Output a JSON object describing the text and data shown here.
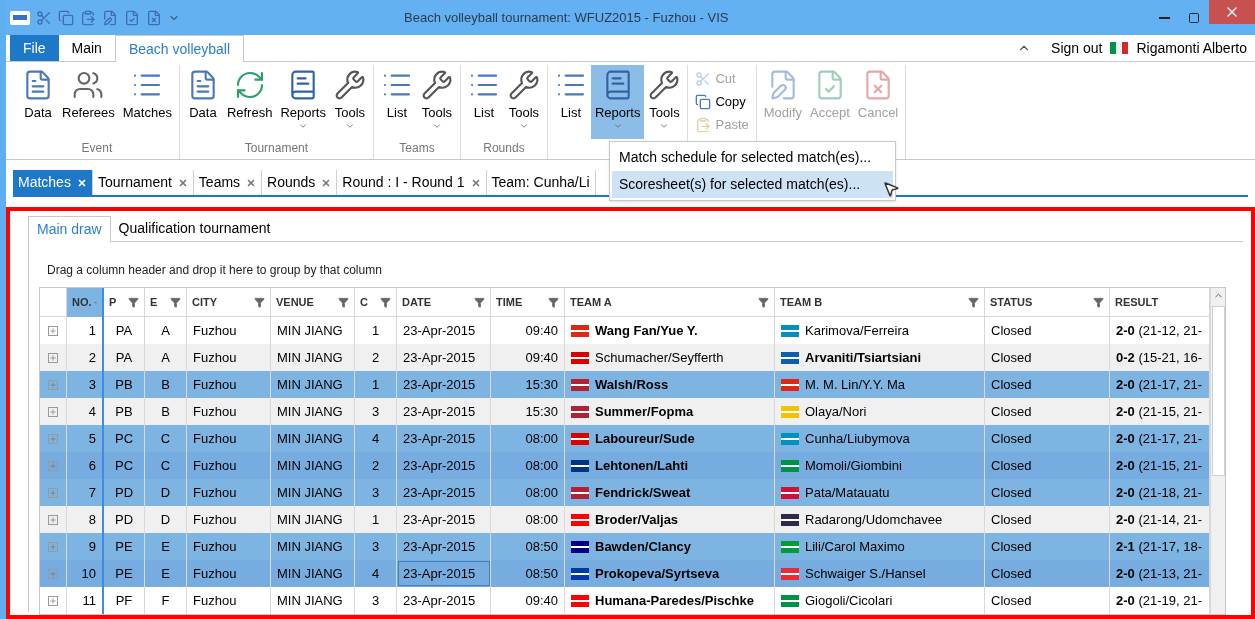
{
  "window": {
    "title": "Beach volleyball tournament: WFUZ2015 - Fuzhou - VIS"
  },
  "ribbon_tabs": [
    {
      "label": "File",
      "kind": "file",
      "selected": false
    },
    {
      "label": "Main",
      "kind": "tab",
      "selected": false
    },
    {
      "label": "Beach volleyball",
      "kind": "tab",
      "selected": true
    }
  ],
  "user": {
    "sign_out": "Sign out",
    "name": "Rigamonti Alberto"
  },
  "ribbon_groups": [
    {
      "label": "Event",
      "buttons": [
        {
          "label": "Data",
          "kind": "large",
          "dropdown": false,
          "pressed": false,
          "disabled": false
        },
        {
          "label": "Referees",
          "kind": "large",
          "dropdown": false,
          "pressed": false,
          "disabled": false
        },
        {
          "label": "Matches",
          "kind": "large",
          "dropdown": false,
          "pressed": false,
          "disabled": false
        }
      ]
    },
    {
      "label": "Tournament",
      "buttons": [
        {
          "label": "Data",
          "kind": "large",
          "dropdown": false,
          "pressed": false,
          "disabled": false
        },
        {
          "label": "Refresh",
          "kind": "large",
          "dropdown": false,
          "pressed": false,
          "disabled": false
        },
        {
          "label": "Reports",
          "kind": "large",
          "dropdown": true,
          "pressed": false,
          "disabled": false
        },
        {
          "label": "Tools",
          "kind": "large",
          "dropdown": true,
          "pressed": false,
          "disabled": false
        }
      ]
    },
    {
      "label": "Teams",
      "buttons": [
        {
          "label": "List",
          "kind": "large",
          "dropdown": false,
          "pressed": false,
          "disabled": false
        },
        {
          "label": "Tools",
          "kind": "large",
          "dropdown": true,
          "pressed": false,
          "disabled": false
        }
      ]
    },
    {
      "label": "Rounds",
      "buttons": [
        {
          "label": "List",
          "kind": "large",
          "dropdown": false,
          "pressed": false,
          "disabled": false
        },
        {
          "label": "Tools",
          "kind": "large",
          "dropdown": true,
          "pressed": false,
          "disabled": false
        }
      ]
    },
    {
      "buttons": [
        {
          "label": "List",
          "kind": "large",
          "dropdown": false,
          "pressed": false,
          "disabled": false
        },
        {
          "label": "Reports",
          "kind": "large",
          "dropdown": true,
          "pressed": true,
          "disabled": false
        },
        {
          "label": "Tools",
          "kind": "large",
          "dropdown": true,
          "pressed": false,
          "disabled": false
        }
      ]
    },
    {
      "buttons": [
        {
          "label": "Cut",
          "kind": "small",
          "disabled": true
        },
        {
          "label": "Copy",
          "kind": "small",
          "disabled": false
        },
        {
          "label": "Paste",
          "kind": "small",
          "disabled": true
        }
      ]
    },
    {
      "buttons": [
        {
          "label": "Modify",
          "kind": "large",
          "dropdown": false,
          "pressed": false,
          "disabled": true
        },
        {
          "label": "Accept",
          "kind": "large",
          "dropdown": false,
          "pressed": false,
          "disabled": true
        },
        {
          "label": "Cancel",
          "kind": "large",
          "dropdown": false,
          "pressed": false,
          "disabled": true
        }
      ]
    }
  ],
  "reports_menu": {
    "items": [
      {
        "label": "Match schedule for selected match(es)...",
        "selected": false
      },
      {
        "label": "Scoresheet(s) for selected match(es)...",
        "selected": true
      }
    ]
  },
  "document_tabs": [
    {
      "label": "Matches",
      "selected": true
    },
    {
      "label": "Tournament",
      "selected": false
    },
    {
      "label": "Teams",
      "selected": false
    },
    {
      "label": "Rounds",
      "selected": false
    },
    {
      "label": "Round : I - Round 1",
      "selected": false
    },
    {
      "label": "Team: Cunha/Li",
      "selected": false
    }
  ],
  "view_tabs": [
    {
      "label": "Main draw",
      "selected": true
    },
    {
      "label": "Qualification tournament",
      "selected": false
    }
  ],
  "group_hint": "Drag a column header and drop it here to group by that column",
  "table": {
    "columns": [
      {
        "label": "NO.",
        "sorted": true,
        "filter": false
      },
      {
        "label": "P",
        "sorted": false,
        "filter": true
      },
      {
        "label": "E",
        "sorted": false,
        "filter": true
      },
      {
        "label": "CITY",
        "sorted": false,
        "filter": true
      },
      {
        "label": "VENUE",
        "sorted": false,
        "filter": true
      },
      {
        "label": "C",
        "sorted": false,
        "filter": true
      },
      {
        "label": "DATE",
        "sorted": false,
        "filter": true
      },
      {
        "label": "TIME",
        "sorted": false,
        "filter": true
      },
      {
        "label": "TEAM A",
        "sorted": false,
        "filter": true
      },
      {
        "label": "TEAM B",
        "sorted": false,
        "filter": true
      },
      {
        "label": "STATUS",
        "sorted": false,
        "filter": true
      },
      {
        "label": "RESULT",
        "sorted": false,
        "filter": false
      }
    ],
    "rows": [
      {
        "no": "1",
        "pool": "PA",
        "e": "A",
        "city": "Fuzhou",
        "venue": "MIN JIANG",
        "court": "1",
        "date": "23-Apr-2015",
        "time": "09:40",
        "team_a": {
          "name": "Wang Fan/Yue Y.",
          "color": "#de2910",
          "winner": true
        },
        "team_b": {
          "name": "Karimova/Ferreira",
          "color": "#0092bc",
          "winner": false
        },
        "status": "Closed",
        "result": "**2-0** (21-12, 21-",
        "selected": false,
        "focused": false
      },
      {
        "no": "2",
        "pool": "PA",
        "e": "A",
        "city": "Fuzhou",
        "venue": "MIN JIANG",
        "court": "2",
        "date": "23-Apr-2015",
        "time": "09:40",
        "team_a": {
          "name": "Schumacher/Seyfferth",
          "color": "#dd0000",
          "winner": false
        },
        "team_b": {
          "name": "Arvaniti/Tsiartsiani",
          "color": "#0d5eaf",
          "winner": true
        },
        "status": "Closed",
        "result": "**0-2** (15-21, 16-",
        "selected": false,
        "focused": false
      },
      {
        "no": "3",
        "pool": "PB",
        "e": "B",
        "city": "Fuzhou",
        "venue": "MIN JIANG",
        "court": "1",
        "date": "23-Apr-2015",
        "time": "15:30",
        "team_a": {
          "name": "Walsh/Ross",
          "color": "#b22234",
          "winner": true
        },
        "team_b": {
          "name": "M. M. Lin/Y.Y. Ma",
          "color": "#de2910",
          "winner": false
        },
        "status": "Closed",
        "result": "**2-0** (21-17, 21-",
        "selected": true,
        "focused": false
      },
      {
        "no": "4",
        "pool": "PB",
        "e": "B",
        "city": "Fuzhou",
        "venue": "MIN JIANG",
        "court": "3",
        "date": "23-Apr-2015",
        "time": "15:30",
        "team_a": {
          "name": "Summer/Fopma",
          "color": "#b22234",
          "winner": true
        },
        "team_b": {
          "name": "Olaya/Nori",
          "color": "#f4c300",
          "winner": false
        },
        "status": "Closed",
        "result": "**2-0** (21-15, 21-",
        "selected": false,
        "focused": false
      },
      {
        "no": "5",
        "pool": "PC",
        "e": "C",
        "city": "Fuzhou",
        "venue": "MIN JIANG",
        "court": "4",
        "date": "23-Apr-2015",
        "time": "08:00",
        "team_a": {
          "name": "Laboureur/Sude",
          "color": "#dd0000",
          "winner": true
        },
        "team_b": {
          "name": "Cunha/Liubymova",
          "color": "#0092bc",
          "winner": false
        },
        "status": "Closed",
        "result": "**2-0** (21-17, 21-",
        "selected": true,
        "focused": false
      },
      {
        "no": "6",
        "pool": "PC",
        "e": "C",
        "city": "Fuzhou",
        "venue": "MIN JIANG",
        "court": "2",
        "date": "23-Apr-2015",
        "time": "08:00",
        "team_a": {
          "name": "Lehtonen/Lahti",
          "color": "#003580",
          "winner": true
        },
        "team_b": {
          "name": "Momoli/Giombini",
          "color": "#009246",
          "winner": false
        },
        "status": "Closed",
        "result": "**2-0** (21-15, 21-",
        "selected": true,
        "focused": false
      },
      {
        "no": "7",
        "pool": "PD",
        "e": "D",
        "city": "Fuzhou",
        "venue": "MIN JIANG",
        "court": "3",
        "date": "23-Apr-2015",
        "time": "08:00",
        "team_a": {
          "name": "Fendrick/Sweat",
          "color": "#b22234",
          "winner": true
        },
        "team_b": {
          "name": "Pata/Matauatu",
          "color": "#d21034",
          "winner": false
        },
        "status": "Closed",
        "result": "**2-0** (21-18, 21-",
        "selected": true,
        "focused": false
      },
      {
        "no": "8",
        "pool": "PD",
        "e": "D",
        "city": "Fuzhou",
        "venue": "MIN JIANG",
        "court": "1",
        "date": "23-Apr-2015",
        "time": "08:00",
        "team_a": {
          "name": "Broder/Valjas",
          "color": "#ff0000",
          "winner": true
        },
        "team_b": {
          "name": "Radarong/Udomchavee",
          "color": "#2d2a4a",
          "winner": false
        },
        "status": "Closed",
        "result": "**2-0** (21-14, 21-",
        "selected": false,
        "focused": false
      },
      {
        "no": "9",
        "pool": "PE",
        "e": "E",
        "city": "Fuzhou",
        "venue": "MIN JIANG",
        "court": "3",
        "date": "23-Apr-2015",
        "time": "08:50",
        "team_a": {
          "name": "Bawden/Clancy",
          "color": "#00008b",
          "winner": true
        },
        "team_b": {
          "name": "Lili/Carol Maximo",
          "color": "#009c3b",
          "winner": false
        },
        "status": "Closed",
        "result": "**2-1** (21-17, 18-",
        "selected": true,
        "focused": false
      },
      {
        "no": "10",
        "pool": "PE",
        "e": "E",
        "city": "Fuzhou",
        "venue": "MIN JIANG",
        "court": "4",
        "date": "23-Apr-2015",
        "time": "08:50",
        "team_a": {
          "name": "Prokopeva/Syrtseva",
          "color": "#0039a6",
          "winner": true
        },
        "team_b": {
          "name": "Schwaiger S./Hansel",
          "color": "#ed2939",
          "winner": false
        },
        "status": "Closed",
        "result": "**2-0** (21-13, 21-",
        "selected": true,
        "focused": true
      },
      {
        "no": "11",
        "pool": "PF",
        "e": "F",
        "city": "Fuzhou",
        "venue": "MIN JIANG",
        "court": "3",
        "date": "23-Apr-2015",
        "time": "09:40",
        "team_a": {
          "name": "Humana-Paredes/Pischke",
          "color": "#ff0000",
          "winner": true
        },
        "team_b": {
          "name": "Giogoli/Cicolari",
          "color": "#009246",
          "winner": false
        },
        "status": "Closed",
        "result": "**2-0** (21-19, 21-",
        "selected": false,
        "focused": false
      }
    ]
  }
}
